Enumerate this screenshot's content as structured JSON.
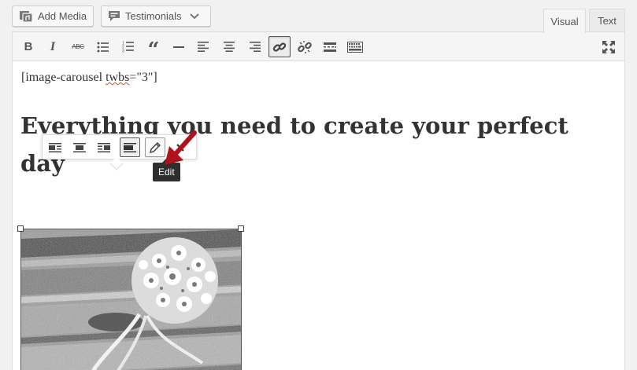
{
  "media_buttons": {
    "add_media": "Add Media",
    "testimonials": "Testimonials"
  },
  "mode_tabs": {
    "visual": "Visual",
    "text": "Text",
    "active": "Visual"
  },
  "toolbar": {
    "buttons": [
      {
        "name": "bold",
        "label": "B"
      },
      {
        "name": "italic",
        "label": "I"
      },
      {
        "name": "strikethrough",
        "label": "ABC"
      },
      {
        "name": "bulleted-list"
      },
      {
        "name": "numbered-list"
      },
      {
        "name": "blockquote"
      },
      {
        "name": "horizontal-line"
      },
      {
        "name": "align-left"
      },
      {
        "name": "align-center"
      },
      {
        "name": "align-right"
      },
      {
        "name": "insert-link",
        "active": true
      },
      {
        "name": "remove-link"
      },
      {
        "name": "read-more"
      },
      {
        "name": "toolbar-toggle"
      },
      {
        "name": "fullscreen"
      }
    ]
  },
  "content": {
    "shortcode_prefix": "[image-carousel ",
    "shortcode_misspelled": "twbs",
    "shortcode_suffix": "=\"3\"]",
    "heading": "Everything you need to create your perfect day"
  },
  "image_toolbar": {
    "buttons": [
      "align-left",
      "align-center",
      "align-right",
      "align-none",
      "edit",
      "remove"
    ],
    "active": "align-none",
    "hovered": "edit"
  },
  "tooltip": {
    "text": "Edit"
  },
  "colors": {
    "annotation_arrow": "#b0121b",
    "tooltip_bg": "#2e2e2e"
  }
}
